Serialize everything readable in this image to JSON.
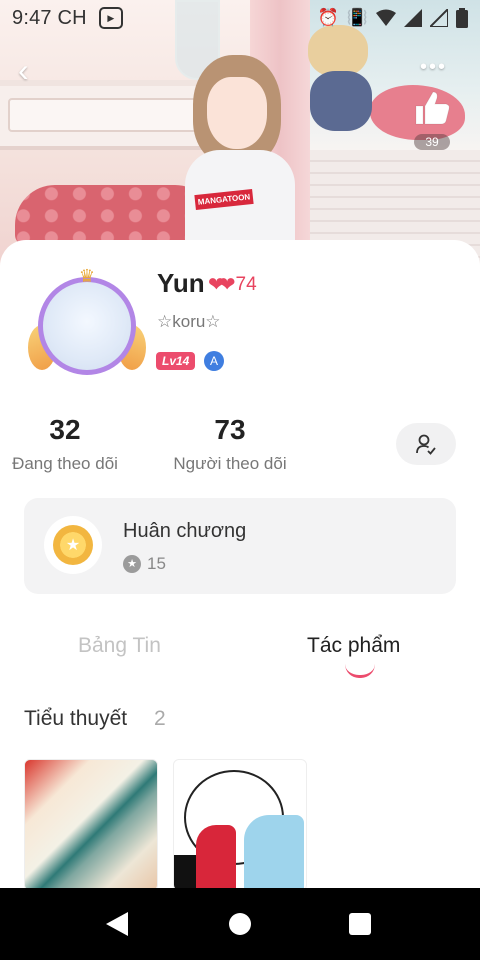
{
  "status_bar": {
    "time": "9:47 CH",
    "icons": [
      "alarm-icon",
      "vibrate-icon",
      "wifi-icon",
      "signal-icon",
      "signal-icon",
      "battery-icon"
    ]
  },
  "header": {
    "back_icon": "‹",
    "more_icon": "•••",
    "like_count": "39",
    "shirt_logo": "MANGATOON"
  },
  "profile": {
    "username": "Yun",
    "heart_level": "74",
    "bio": "☆koru☆",
    "level_badge": "Lv14",
    "vip_badge": "A"
  },
  "stats": {
    "following_count": "32",
    "following_label": "Đang theo dõi",
    "followers_count": "73",
    "followers_label": "Người theo dõi"
  },
  "medals": {
    "title": "Huân chương",
    "count": "15"
  },
  "tabs": [
    {
      "label": "Bảng Tin",
      "active": false
    },
    {
      "label": "Tác phẩm",
      "active": true
    }
  ],
  "works": {
    "section_title": "Tiểu thuyết",
    "section_count": "2"
  },
  "colors": {
    "accent": "#ec4c6d",
    "heart": "#e8445f",
    "muted_text": "#777777"
  }
}
